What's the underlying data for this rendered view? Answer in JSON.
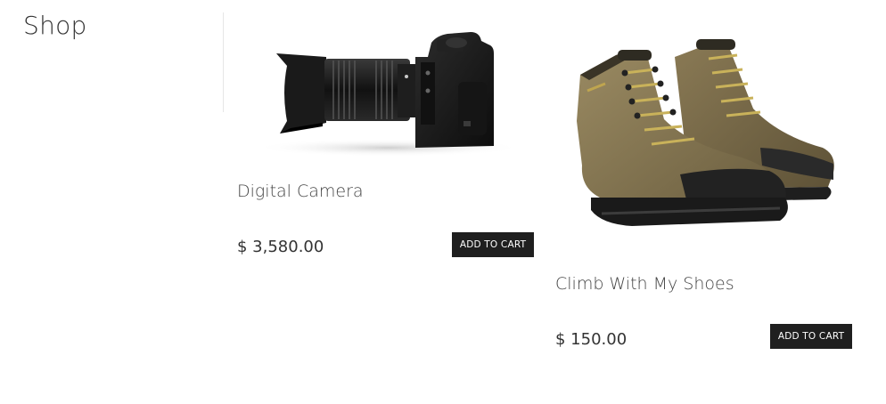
{
  "page": {
    "title": "Shop"
  },
  "products": [
    {
      "name": "Digital Camera",
      "price": "$ 3,580.00",
      "button_label": "ADD TO CART",
      "image": "digital-camera-image"
    },
    {
      "name": "Climb With My Shoes",
      "price": "$ 150.00",
      "button_label": "ADD TO CART",
      "image": "hiking-boots-image"
    }
  ]
}
